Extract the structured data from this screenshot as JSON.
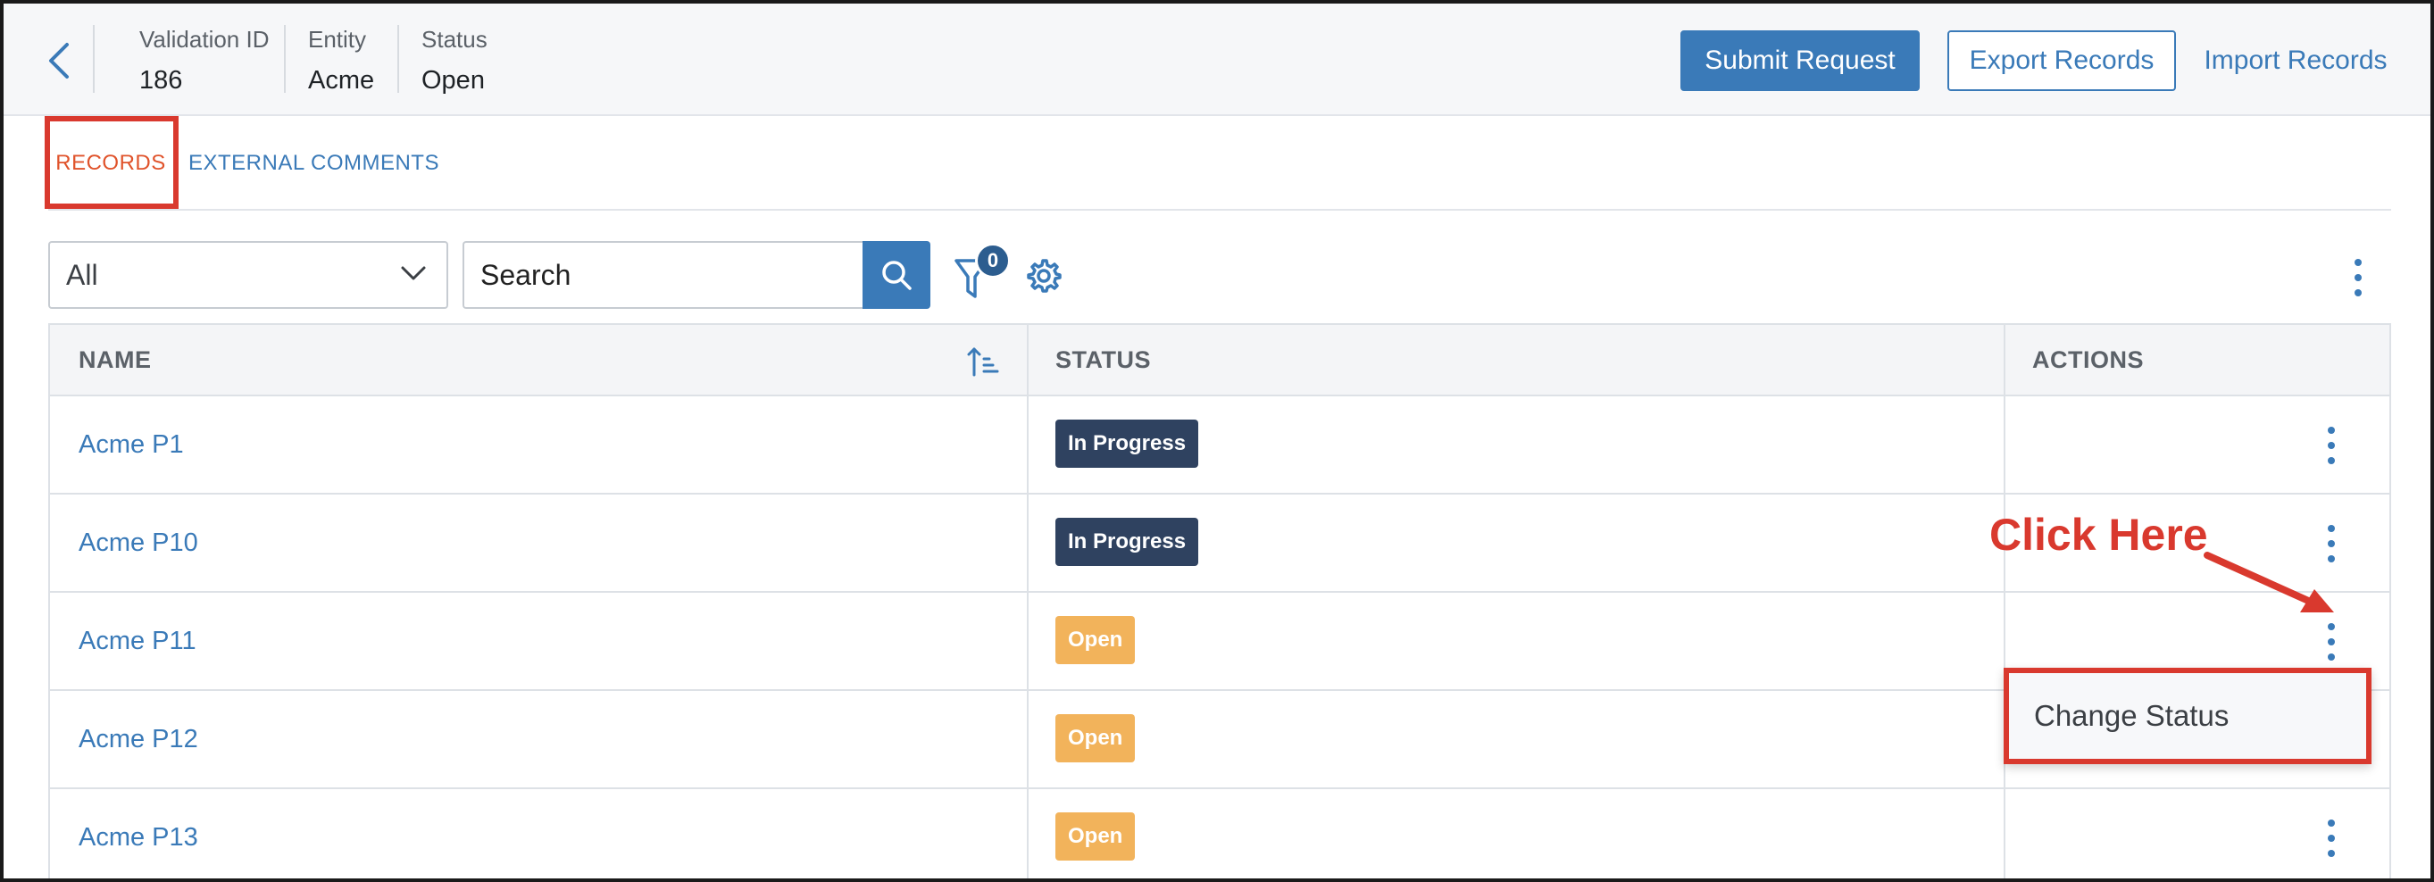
{
  "header": {
    "fields": [
      {
        "label": "Validation ID",
        "value": "186"
      },
      {
        "label": "Entity",
        "value": "Acme"
      },
      {
        "label": "Status",
        "value": "Open"
      }
    ],
    "buttons": {
      "submit": "Submit Request",
      "export": "Export Records",
      "import": "Import Records"
    }
  },
  "tabs": [
    {
      "label": "RECORDS",
      "active": true
    },
    {
      "label": "EXTERNAL COMMENTS",
      "active": false
    }
  ],
  "toolbar": {
    "filter_select": "All",
    "search_placeholder": "Search",
    "filter_count": "0"
  },
  "table": {
    "columns": [
      "NAME",
      "STATUS",
      "ACTIONS"
    ],
    "rows": [
      {
        "name": "Acme P1",
        "status": "In Progress"
      },
      {
        "name": "Acme P10",
        "status": "In Progress"
      },
      {
        "name": "Acme P11",
        "status": "Open"
      },
      {
        "name": "Acme P12",
        "status": "Open"
      },
      {
        "name": "Acme P13",
        "status": "Open"
      }
    ]
  },
  "annotation": {
    "text": "Click Here"
  },
  "menu": {
    "items": [
      "Change Status"
    ]
  },
  "colors": {
    "primary": "#3a7ab8",
    "active_tab": "#e0532b",
    "in_progress": "#2f4260",
    "open": "#f2b35b",
    "annotation": "#d9392e"
  },
  "icons": [
    "chevron-left-icon",
    "chevron-down-icon",
    "search-icon",
    "filter-icon",
    "gear-icon",
    "kebab-icon",
    "sort-ascending-icon",
    "arrow-icon"
  ]
}
